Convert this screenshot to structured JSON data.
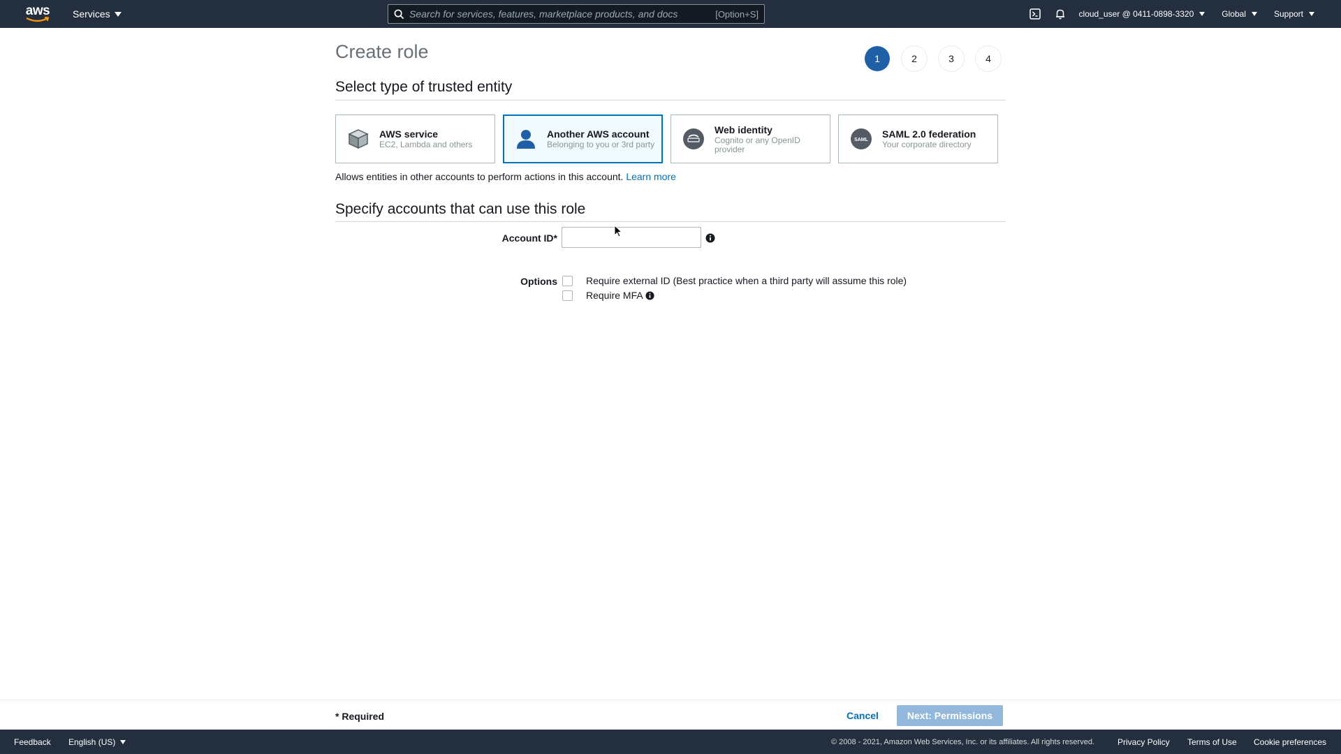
{
  "topnav": {
    "logo_text": "aws",
    "services_label": "Services",
    "search_placeholder": "Search for services, features, marketplace products, and docs",
    "search_shortcut": "[Option+S]",
    "account_label": "cloud_user @ 0411-0898-3320",
    "region_label": "Global",
    "support_label": "Support"
  },
  "page": {
    "title": "Create role",
    "steps": [
      "1",
      "2",
      "3",
      "4"
    ],
    "active_step": "1"
  },
  "trusted_entity": {
    "heading": "Select type of trusted entity",
    "options": [
      {
        "label": "AWS service",
        "sub": "EC2, Lambda and others",
        "icon": "cube-icon"
      },
      {
        "label": "Another AWS account",
        "sub": "Belonging to you or 3rd party",
        "icon": "user-icon"
      },
      {
        "label": "Web identity",
        "sub": "Cognito or any OpenID provider",
        "icon": "openid-icon"
      },
      {
        "label": "SAML 2.0 federation",
        "sub": "Your corporate directory",
        "icon": "saml-icon"
      }
    ],
    "selected": "Another AWS account",
    "description": "Allows entities in other accounts to perform actions in this account.",
    "learn_more": "Learn more"
  },
  "accounts": {
    "heading": "Specify accounts that can use this role",
    "account_id_label": "Account ID*",
    "account_id_value": "",
    "options_label": "Options",
    "option_external_id": "Require external ID (Best practice when a third party will assume this role)",
    "option_mfa": "Require MFA"
  },
  "actionbar": {
    "required_note": "* Required",
    "cancel_label": "Cancel",
    "next_label": "Next: Permissions"
  },
  "footer": {
    "feedback": "Feedback",
    "language": "English (US)",
    "copyright": "© 2008 - 2021, Amazon Web Services, Inc. or its affiliates. All rights reserved.",
    "privacy": "Privacy Policy",
    "terms": "Terms of Use",
    "cookies": "Cookie preferences"
  },
  "colors": {
    "nav_bg": "#232f3e",
    "accent": "#0073bb",
    "step_active": "#1f5fa8",
    "primary_disabled": "#92b8dc"
  }
}
